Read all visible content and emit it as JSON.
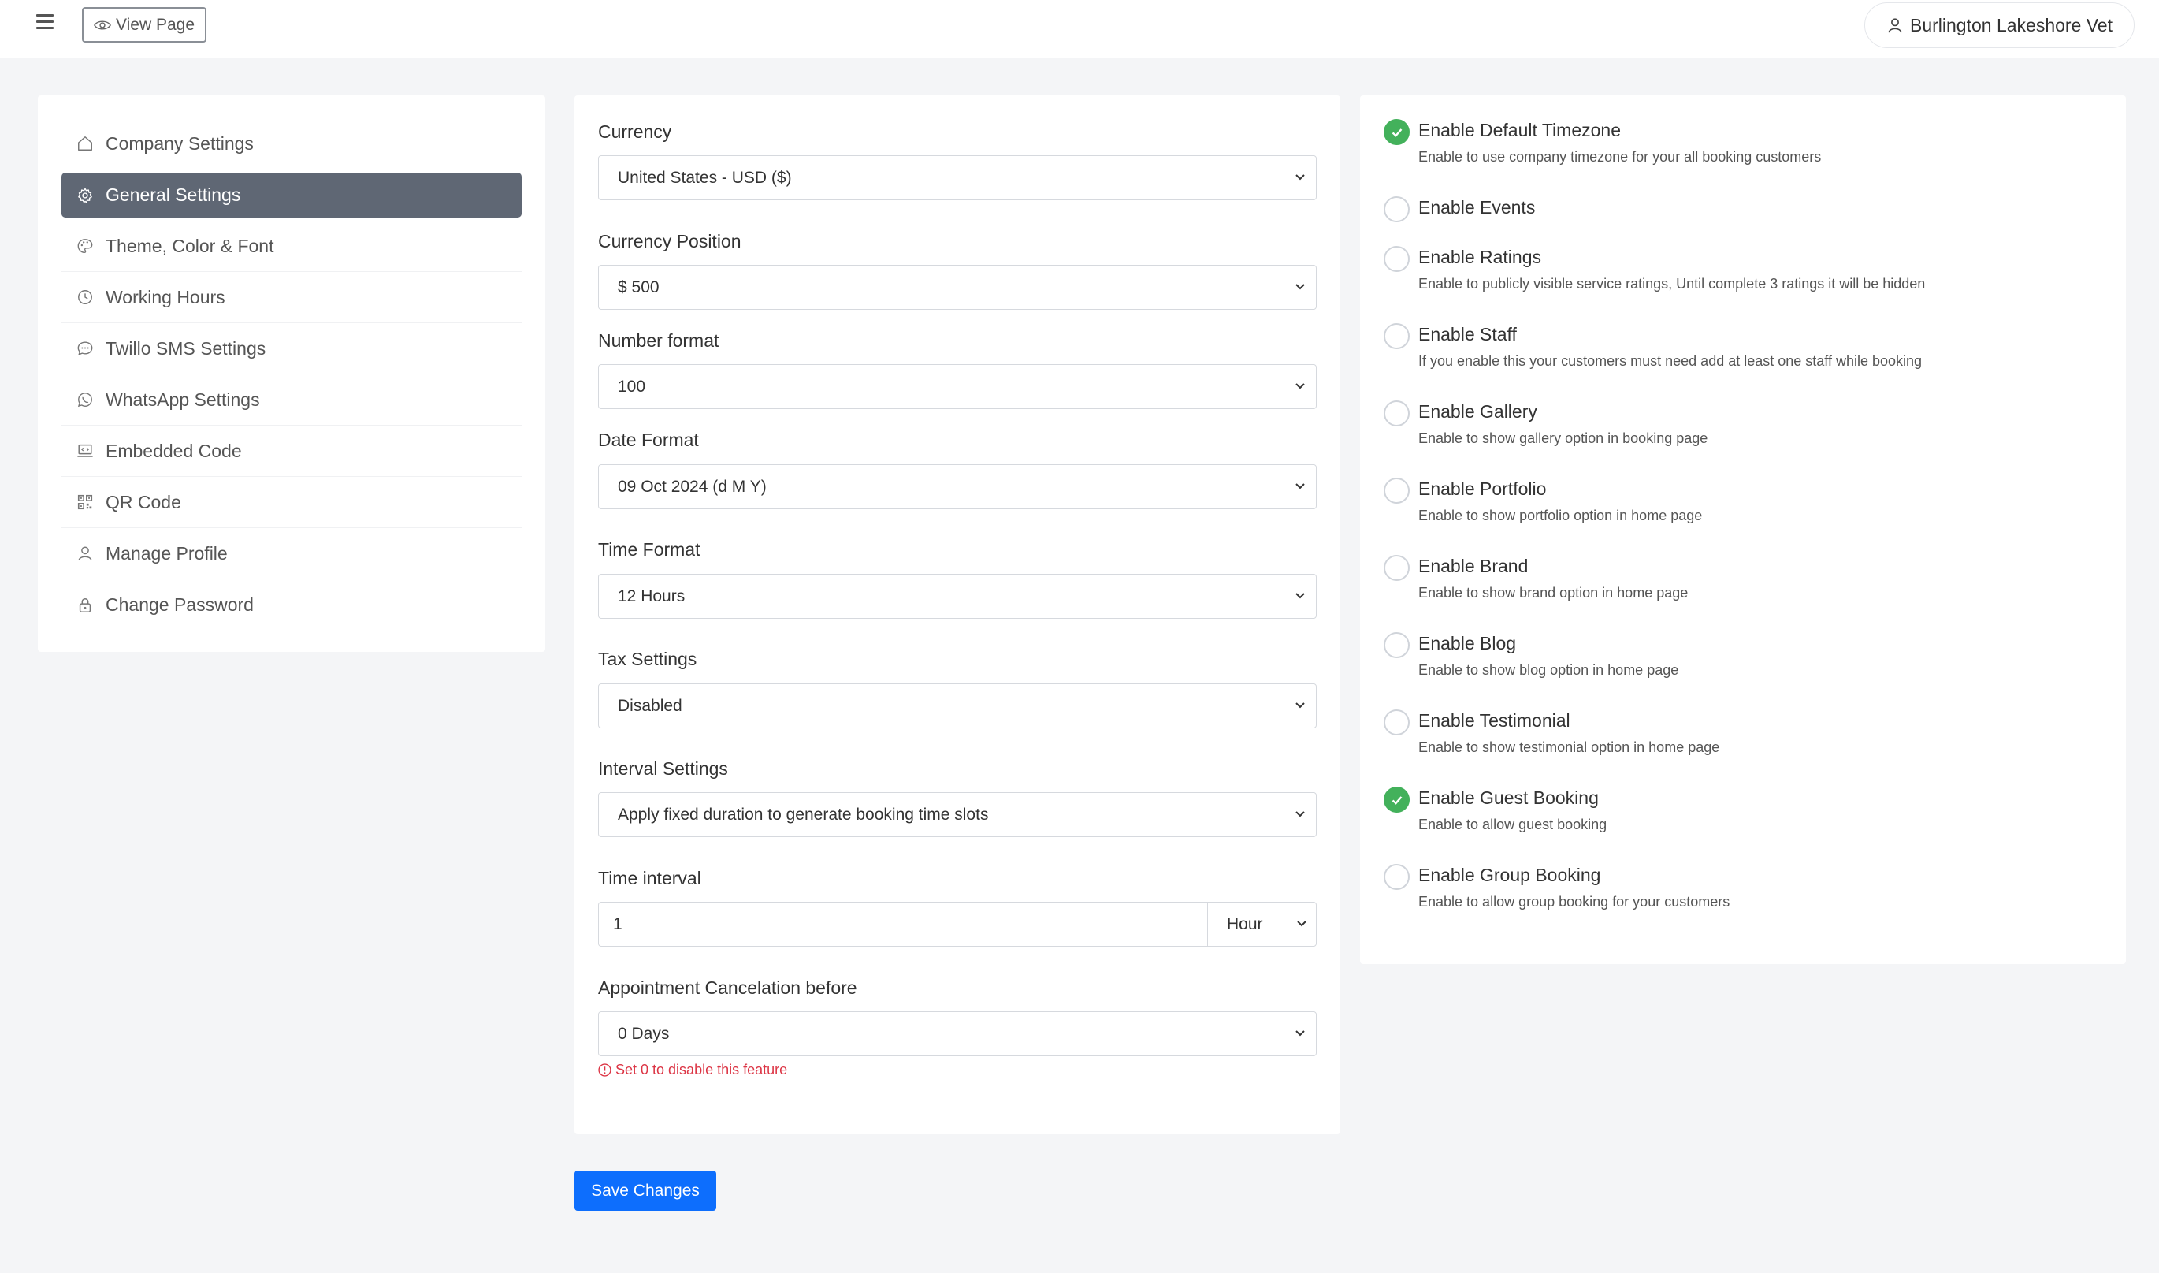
{
  "topbar": {
    "view_page_label": "View Page",
    "user_name": "Burlington Lakeshore Vet"
  },
  "sidebar": {
    "items": [
      {
        "label": "Company Settings",
        "icon": "home-icon",
        "active": false
      },
      {
        "label": "General Settings",
        "icon": "gear-icon",
        "active": true
      },
      {
        "label": "Theme, Color & Font",
        "icon": "palette-icon",
        "active": false
      },
      {
        "label": "Working Hours",
        "icon": "clock-icon",
        "active": false
      },
      {
        "label": "Twillo SMS Settings",
        "icon": "chat-icon",
        "active": false
      },
      {
        "label": "WhatsApp Settings",
        "icon": "whatsapp-icon",
        "active": false
      },
      {
        "label": "Embedded Code",
        "icon": "laptop-code-icon",
        "active": false
      },
      {
        "label": "QR Code",
        "icon": "qr-code-icon",
        "active": false
      },
      {
        "label": "Manage Profile",
        "icon": "user-icon",
        "active": false
      },
      {
        "label": "Change Password",
        "icon": "lock-icon",
        "active": false
      }
    ]
  },
  "form": {
    "currency": {
      "label": "Currency",
      "value": "United States - USD ($)"
    },
    "currency_position": {
      "label": "Currency Position",
      "value": "$ 500"
    },
    "number_format": {
      "label": "Number format",
      "value": "100"
    },
    "date_format": {
      "label": "Date Format",
      "value": "09 Oct 2024 (d M Y)"
    },
    "time_format": {
      "label": "Time Format",
      "value": "12 Hours"
    },
    "tax_settings": {
      "label": "Tax Settings",
      "value": "Disabled"
    },
    "interval_settings": {
      "label": "Interval Settings",
      "value": "Apply fixed duration to generate booking time slots"
    },
    "time_interval": {
      "label": "Time interval",
      "value": "1",
      "unit": "Hour"
    },
    "cancellation": {
      "label": "Appointment Cancelation before",
      "value": "0 Days",
      "hint": "Set 0 to disable this feature"
    },
    "save_label": "Save Changes"
  },
  "toggles": [
    {
      "title": "Enable Default Timezone",
      "desc": "Enable to use company timezone for your all booking customers",
      "checked": true
    },
    {
      "title": "Enable Events",
      "desc": "",
      "checked": false
    },
    {
      "title": "Enable Ratings",
      "desc": "Enable to publicly visible service ratings, Until complete 3 ratings it will be hidden",
      "checked": false
    },
    {
      "title": "Enable Staff",
      "desc": "If you enable this your customers must need add at least one staff while booking",
      "checked": false
    },
    {
      "title": "Enable Gallery",
      "desc": "Enable to show gallery option in booking page",
      "checked": false
    },
    {
      "title": "Enable Portfolio",
      "desc": "Enable to show portfolio option in home page",
      "checked": false
    },
    {
      "title": "Enable Brand",
      "desc": "Enable to show brand option in home page",
      "checked": false
    },
    {
      "title": "Enable Blog",
      "desc": "Enable to show blog option in home page",
      "checked": false
    },
    {
      "title": "Enable Testimonial",
      "desc": "Enable to show testimonial option in home page",
      "checked": false
    },
    {
      "title": "Enable Guest Booking",
      "desc": "Enable to allow guest booking",
      "checked": true
    },
    {
      "title": "Enable Group Booking",
      "desc": "Enable to allow group booking for your customers",
      "checked": false
    }
  ],
  "colors": {
    "accent": "#0d6efd",
    "active_menu": "#5f6774",
    "check_on": "#43b15b",
    "hint": "#dc3545"
  }
}
